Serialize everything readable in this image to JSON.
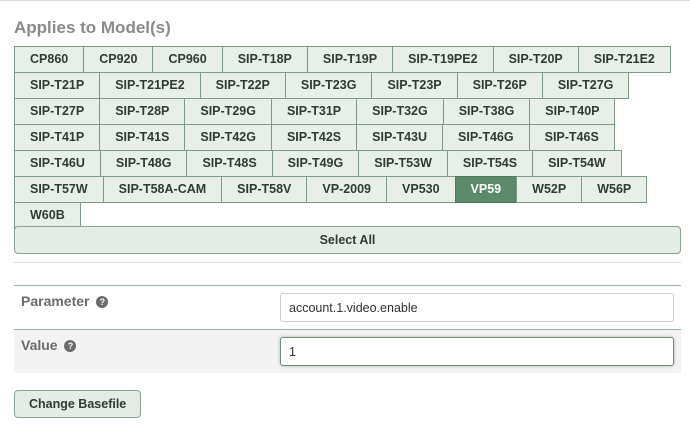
{
  "title": "Applies to Model(s)",
  "models": [
    "CP860",
    "CP920",
    "CP960",
    "SIP-T18P",
    "SIP-T19P",
    "SIP-T19PE2",
    "SIP-T20P",
    "SIP-T21E2",
    "SIP-T21P",
    "SIP-T21PE2",
    "SIP-T22P",
    "SIP-T23G",
    "SIP-T23P",
    "SIP-T26P",
    "SIP-T27G",
    "SIP-T27P",
    "SIP-T28P",
    "SIP-T29G",
    "SIP-T31P",
    "SIP-T32G",
    "SIP-T38G",
    "SIP-T40P",
    "SIP-T41P",
    "SIP-T41S",
    "SIP-T42G",
    "SIP-T42S",
    "SIP-T43U",
    "SIP-T46G",
    "SIP-T46S",
    "SIP-T46U",
    "SIP-T48G",
    "SIP-T48S",
    "SIP-T49G",
    "SIP-T53W",
    "SIP-T54S",
    "SIP-T54W",
    "SIP-T57W",
    "SIP-T58A-CAM",
    "SIP-T58V",
    "VP-2009",
    "VP530",
    "VP59",
    "W52P",
    "W56P",
    "W60B"
  ],
  "selected_model": "VP59",
  "select_all_label": "Select All",
  "parameter": {
    "label": "Parameter",
    "value": "account.1.video.enable"
  },
  "value": {
    "label": "Value",
    "value": "1"
  },
  "change_basefile_label": "Change Basefile",
  "colors": {
    "selected_bg": "#5b8a6a",
    "button_bg": "#e8efe9",
    "border": "#7d9a84"
  }
}
